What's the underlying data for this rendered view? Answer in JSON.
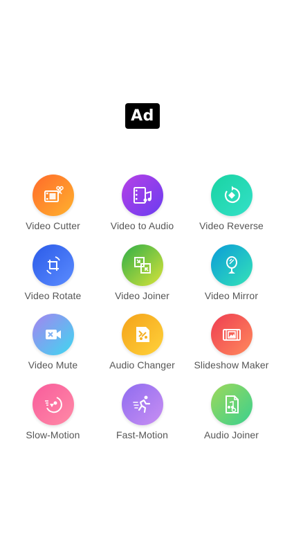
{
  "ad": {
    "label": "Ad"
  },
  "tools": [
    {
      "label": "Video Cutter",
      "icon": "film-scissors-icon",
      "gradient": [
        "#ff6a2a",
        "#ffb22e"
      ]
    },
    {
      "label": "Video to Audio",
      "icon": "film-music-icon",
      "gradient": [
        "#b640e6",
        "#6a3df0"
      ]
    },
    {
      "label": "Video Reverse",
      "icon": "reverse-rotate-icon",
      "gradient": [
        "#19d3a2",
        "#34e0c8"
      ]
    },
    {
      "label": "Video Rotate",
      "icon": "rotate-crop-icon",
      "gradient": [
        "#2b5be8",
        "#5b8cff"
      ]
    },
    {
      "label": "Video Joiner",
      "icon": "join-squares-icon",
      "gradient": [
        "#2fae48",
        "#d8e33a"
      ]
    },
    {
      "label": "Video Mirror",
      "icon": "mirror-icon",
      "gradient": [
        "#0a9bd8",
        "#35e3b8"
      ]
    },
    {
      "label": "Video Mute",
      "icon": "camera-mute-icon",
      "gradient": [
        "#a483f0",
        "#3ed8f0"
      ]
    },
    {
      "label": "Audio Changer",
      "icon": "audio-changer-icon",
      "gradient": [
        "#f4a21a",
        "#ffd23a"
      ]
    },
    {
      "label": "Slideshow Maker",
      "icon": "slideshow-icon",
      "gradient": [
        "#ee3d52",
        "#ff8a5c"
      ]
    },
    {
      "label": "Slow-Motion",
      "icon": "slow-motion-icon",
      "gradient": [
        "#f85c9c",
        "#ff8aa6"
      ]
    },
    {
      "label": "Fast-Motion",
      "icon": "fast-motion-runner-icon",
      "gradient": [
        "#8f6cf0",
        "#c88ff2"
      ]
    },
    {
      "label": "Audio Joiner",
      "icon": "audio-file-icon",
      "gradient": [
        "#9ed85a",
        "#3ad08e"
      ]
    }
  ]
}
